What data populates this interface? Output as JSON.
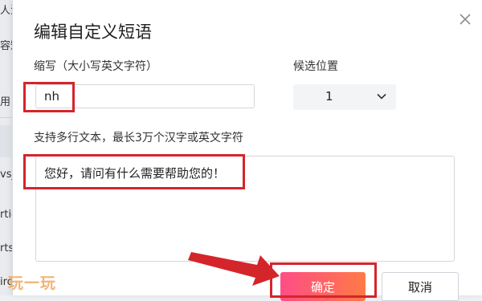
{
  "background": {
    "fragments": [
      "人法",
      "容短",
      "用",
      "vsj",
      "rtic",
      "rts",
      "irc"
    ],
    "watermark": "玩一玩"
  },
  "dialog": {
    "title": "编辑自定义短语",
    "abbr_label": "缩写（大小写英文字符）",
    "abbr_value": "nh",
    "position_label": "候选位置",
    "position_value": "1",
    "hint": "支持多行文本，最长3万个汉字或英文字符",
    "content_value": "您好，请问有什么需要帮助您的！",
    "ok_label": "确定",
    "cancel_label": "取消"
  },
  "annotations": {
    "highlight_color": "#d4252b",
    "ok_gradient": [
      "#ff4d86",
      "#ff7a45"
    ]
  }
}
